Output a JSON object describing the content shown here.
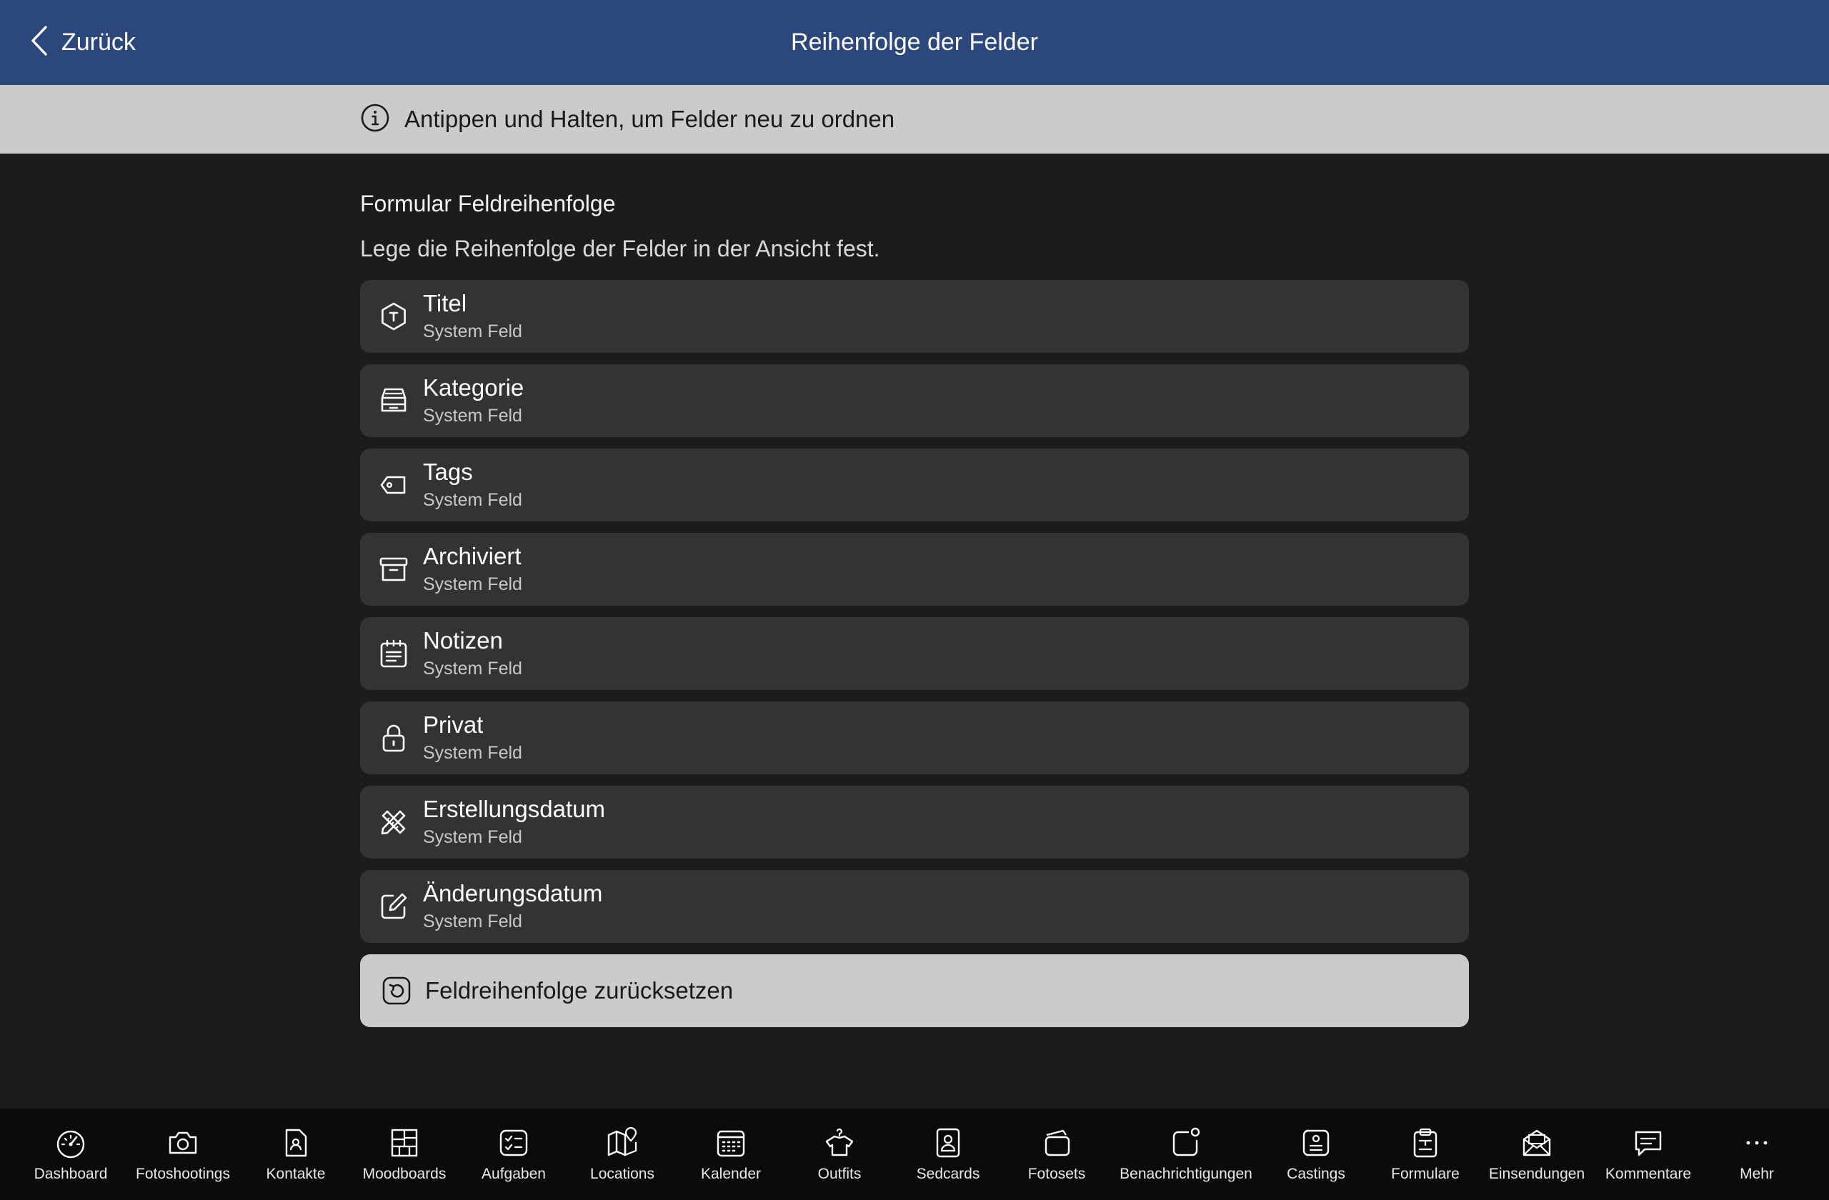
{
  "header": {
    "back_label": "Zurück",
    "title": "Reihenfolge der Felder"
  },
  "banner": {
    "icon": "info-icon",
    "text": "Antippen und Halten, um Felder neu zu ordnen"
  },
  "section": {
    "title": "Formular Feldreihenfolge",
    "description": "Lege die Reihenfolge der Felder in der Ansicht fest."
  },
  "fields": [
    {
      "name": "Titel",
      "subtitle": "System Feld",
      "icon": "title-hexagon-icon"
    },
    {
      "name": "Kategorie",
      "subtitle": "System Feld",
      "icon": "category-tray-icon"
    },
    {
      "name": "Tags",
      "subtitle": "System Feld",
      "icon": "tag-icon"
    },
    {
      "name": "Archiviert",
      "subtitle": "System Feld",
      "icon": "archive-box-icon"
    },
    {
      "name": "Notizen",
      "subtitle": "System Feld",
      "icon": "notes-icon"
    },
    {
      "name": "Privat",
      "subtitle": "System Feld",
      "icon": "lock-icon"
    },
    {
      "name": "Erstellungsdatum",
      "subtitle": "System Feld",
      "icon": "pencil-ruler-icon"
    },
    {
      "name": "Änderungsdatum",
      "subtitle": "System Feld",
      "icon": "edit-icon"
    }
  ],
  "reset_button": {
    "label": "Feldreihenfolge zurücksetzen",
    "icon": "reset-icon"
  },
  "tabs": [
    {
      "label": "Dashboard",
      "icon": "dashboard-gauge-icon"
    },
    {
      "label": "Fotoshootings",
      "icon": "camera-icon"
    },
    {
      "label": "Kontakte",
      "icon": "contact-file-icon"
    },
    {
      "label": "Moodboards",
      "icon": "moodboard-grid-icon"
    },
    {
      "label": "Aufgaben",
      "icon": "tasks-checklist-icon"
    },
    {
      "label": "Locations",
      "icon": "map-pin-icon"
    },
    {
      "label": "Kalender",
      "icon": "calendar-icon"
    },
    {
      "label": "Outfits",
      "icon": "shirt-hanger-icon"
    },
    {
      "label": "Sedcards",
      "icon": "sedcard-portrait-icon"
    },
    {
      "label": "Fotosets",
      "icon": "photo-stack-icon"
    },
    {
      "label": "Benachrichtigungen",
      "icon": "notification-badge-icon"
    },
    {
      "label": "Castings",
      "icon": "casting-id-icon"
    },
    {
      "label": "Formulare",
      "icon": "clipboard-form-icon"
    },
    {
      "label": "Einsendungen",
      "icon": "mail-open-icon"
    },
    {
      "label": "Kommentare",
      "icon": "comment-icon"
    },
    {
      "label": "Mehr",
      "icon": "more-dots-icon"
    }
  ],
  "colors": {
    "header_bg": "#2c477c",
    "page_bg": "#1c1c1c",
    "row_bg": "#333333",
    "banner_bg": "#cbcbcb",
    "tabbar_bg": "#0b0b0b"
  }
}
